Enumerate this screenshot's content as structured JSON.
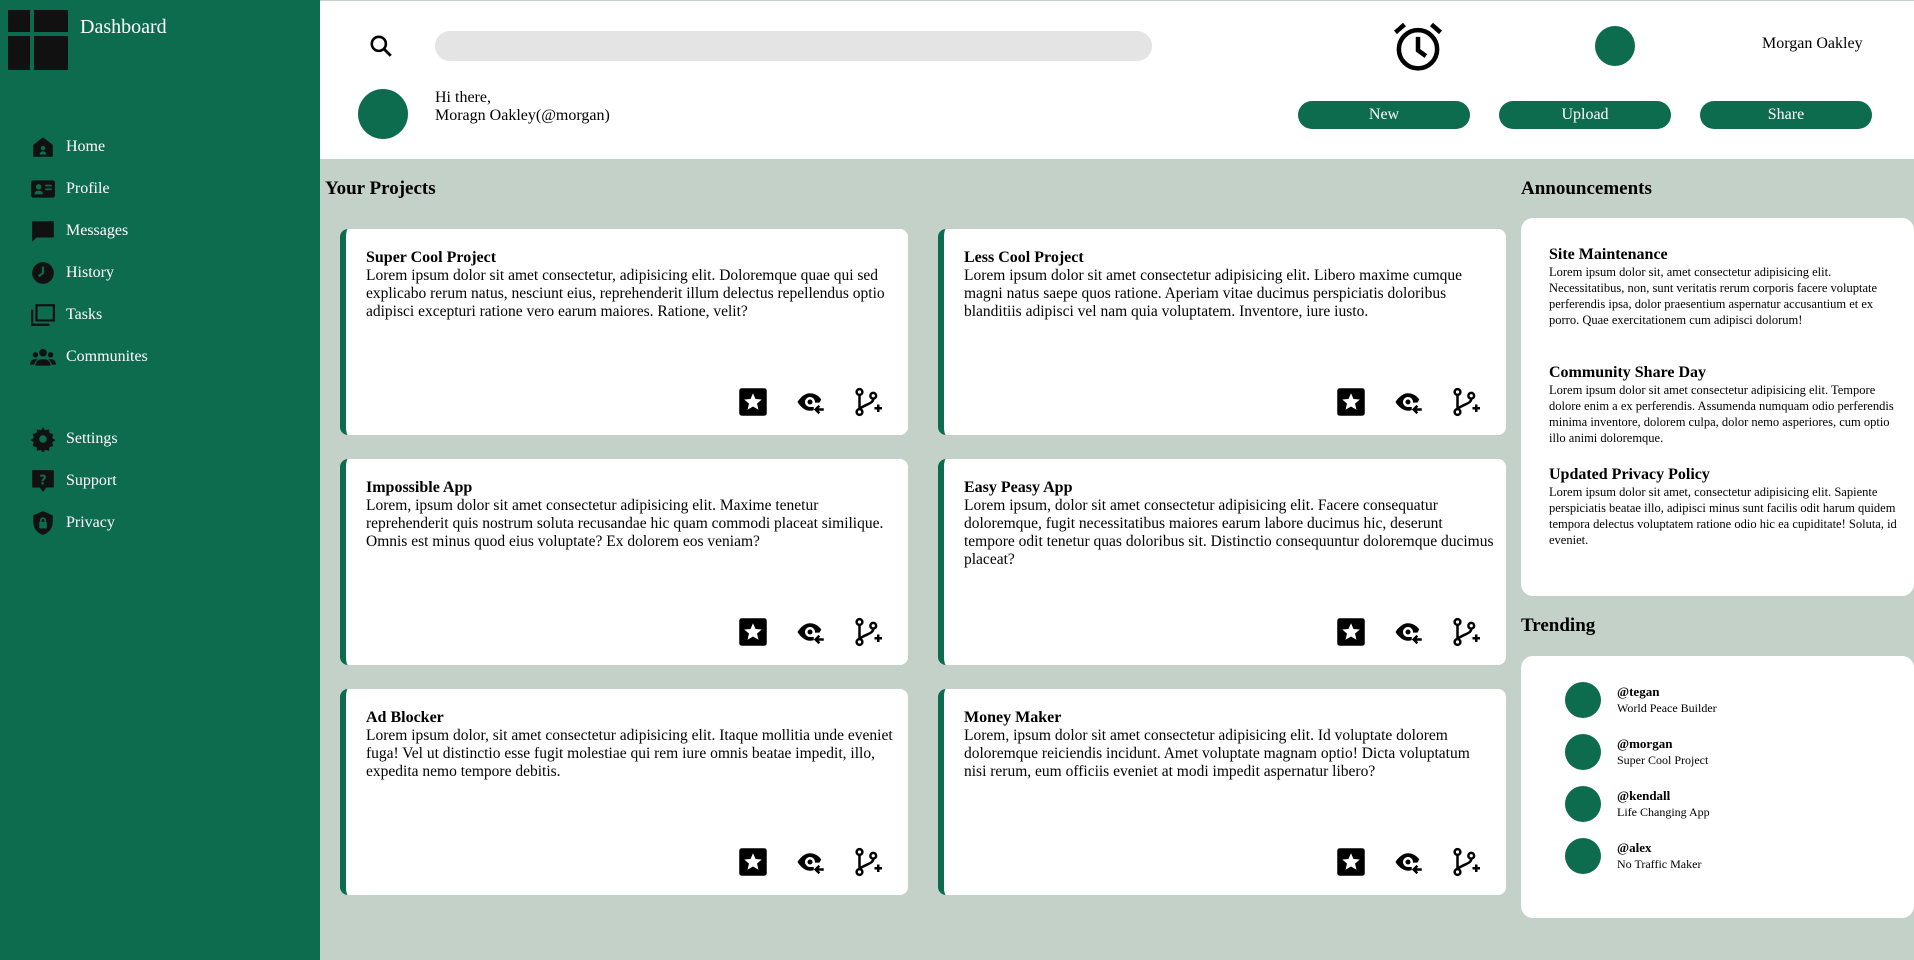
{
  "sidebar": {
    "brand_title": "Dashboard",
    "items": [
      {
        "label": "Home",
        "icon": "home-icon"
      },
      {
        "label": "Profile",
        "icon": "profile-card-icon"
      },
      {
        "label": "Messages",
        "icon": "message-icon"
      },
      {
        "label": "History",
        "icon": "history-icon"
      },
      {
        "label": "Tasks",
        "icon": "tasks-icon"
      },
      {
        "label": "Communites",
        "icon": "people-icon"
      }
    ],
    "secondary_items": [
      {
        "label": "Settings",
        "icon": "gear-icon"
      },
      {
        "label": "Support",
        "icon": "help-icon"
      },
      {
        "label": "Privacy",
        "icon": "shield-lock-icon"
      }
    ]
  },
  "header": {
    "search_placeholder": "",
    "user_name": "Morgan Oakley",
    "greeting_line1": "Hi there,",
    "greeting_line2": "Moragn Oakley(@morgan)",
    "buttons": {
      "new": "New",
      "upload": "Upload",
      "share": "Share"
    }
  },
  "projects": {
    "title": "Your Projects",
    "items": [
      {
        "title": "Super Cool Project",
        "body": "Lorem ipsum dolor sit amet consectetur, adipisicing elit. Doloremque quae qui sed explicabo rerum natus, nesciunt eius, reprehenderit illum delectus repellendus optio adipisci excepturi ratione vero earum maiores. Ratione, velit?"
      },
      {
        "title": "Less Cool Project",
        "body": "Lorem ipsum dolor sit amet consectetur adipisicing elit. Libero maxime cumque magni natus saepe quos ratione. Aperiam vitae ducimus perspiciatis doloribus blanditiis adipisci vel nam quia voluptatem. Inventore, iure iusto."
      },
      {
        "title": "Impossible App",
        "body": "Lorem, ipsum dolor sit amet consectetur adipisicing elit. Maxime tenetur reprehenderit quis nostrum soluta recusandae hic quam commodi placeat similique. Omnis est minus quod eius voluptate? Ex dolorem eos veniam?"
      },
      {
        "title": "Easy Peasy App",
        "body": "Lorem ipsum, dolor sit amet consectetur adipisicing elit. Facere consequatur doloremque, fugit necessitatibus maiores earum labore ducimus hic, deserunt tempore odit tenetur quas doloribus sit. Distinctio consequuntur doloremque ducimus placeat?"
      },
      {
        "title": "Ad Blocker",
        "body": "Lorem ipsum dolor, sit amet consectetur adipisicing elit. Itaque mollitia unde eveniet fuga! Vel ut distinctio esse fugit molestiae qui rem iure omnis beatae impedit, illo, expedita nemo tempore debitis."
      },
      {
        "title": "Money Maker",
        "body": "Lorem, ipsum dolor sit amet consectetur adipisicing elit. Id voluptate dolorem doloremque reiciendis incidunt. Amet voluptate magnam optio! Dicta voluptatum nisi rerum, eum officiis eveniet at modi impedit aspernatur libero?"
      }
    ]
  },
  "announcements": {
    "title": "Announcements",
    "items": [
      {
        "title": "Site Maintenance",
        "body": "Lorem ipsum dolor sit, amet consectetur adipisicing elit. Necessitatibus, non, sunt veritatis rerum corporis facere voluptate perferendis ipsa, dolor praesentium aspernatur accusantium et ex porro. Quae exercitationem cum adipisci dolorum!"
      },
      {
        "title": "Community Share Day",
        "body": "Lorem ipsum dolor sit amet consectetur adipisicing elit. Tempore dolore enim a ex perferendis. Assumenda numquam odio perferendis minima inventore, dolorem culpa, dolor nemo asperiores, cum optio illo animi doloremque."
      },
      {
        "title": "Updated Privacy Policy",
        "body": "Lorem ipsum dolor sit amet, consectetur adipisicing elit. Sapiente perspiciatis beatae illo, adipisci minus sunt facilis odit harum quidem tempora delectus voluptatem ratione odio hic ea cupiditate! Soluta, id eveniet."
      }
    ]
  },
  "trending": {
    "title": "Trending",
    "items": [
      {
        "user": "@tegan",
        "desc": "World Peace Builder"
      },
      {
        "user": "@morgan",
        "desc": "Super Cool Project"
      },
      {
        "user": "@kendall",
        "desc": "Life Changing App"
      },
      {
        "user": "@alex",
        "desc": "No Traffic Maker"
      }
    ]
  },
  "colors": {
    "brand": "#0d6b4e",
    "background": "#c3d1c9",
    "search_bg": "#e4e4e4"
  }
}
